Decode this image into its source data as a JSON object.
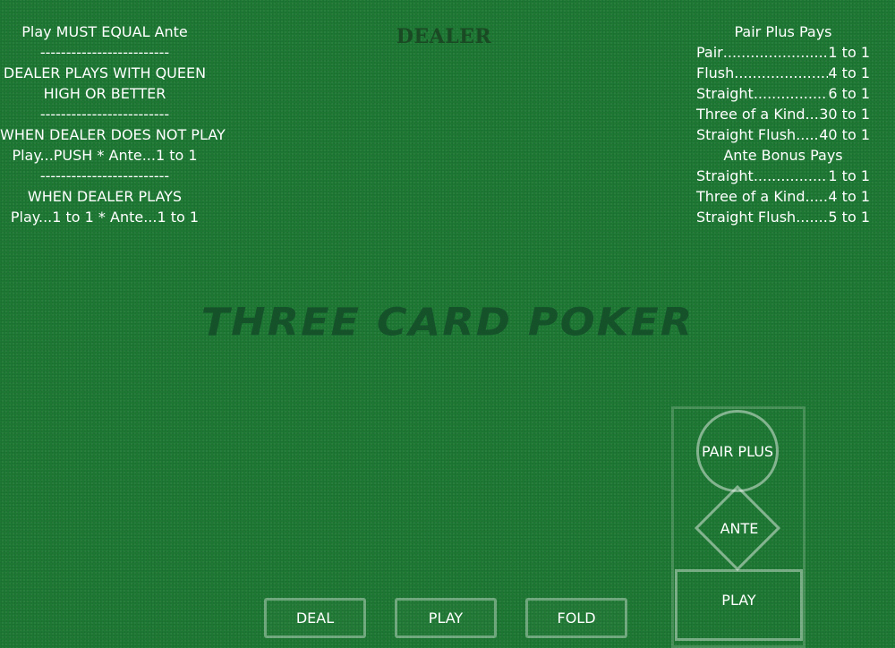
{
  "rules": {
    "lines": [
      "Play MUST EQUAL Ante",
      "-------------------------",
      "DEALER PLAYS WITH QUEEN",
      "HIGH OR BETTER",
      "-------------------------",
      "WHEN DEALER DOES NOT PLAY",
      "Play...PUSH * Ante...1 to 1",
      "-------------------------",
      "WHEN DEALER PLAYS",
      "Play...1 to 1 * Ante...1 to 1"
    ]
  },
  "dealer_label": "DEALER",
  "paytable": {
    "pair_plus_title": "Pair Plus Pays",
    "pair_plus": [
      {
        "hand": "Pair",
        "pay": "1 to 1"
      },
      {
        "hand": "Flush",
        "pay": "4 to 1"
      },
      {
        "hand": "Straight",
        "pay": "6 to 1"
      },
      {
        "hand": "Three of a Kind",
        "pay": "30 to 1"
      },
      {
        "hand": "Straight Flush",
        "pay": "40 to 1"
      }
    ],
    "ante_bonus_title": "Ante Bonus Pays",
    "ante_bonus": [
      {
        "hand": "Straight",
        "pay": "1 to 1"
      },
      {
        "hand": "Three of a Kind",
        "pay": "4 to 1"
      },
      {
        "hand": "Straight Flush",
        "pay": "5 to 1"
      }
    ]
  },
  "table_title": "THREE CARD POKER",
  "bet_spots": {
    "pair_plus": "PAIR PLUS",
    "ante": "ANTE",
    "play": "PLAY"
  },
  "buttons": {
    "deal": "DEAL",
    "play": "PLAY",
    "fold": "FOLD"
  },
  "colors": {
    "felt": "#1e7a34",
    "title_text": "#15522a",
    "text": "#ffffff"
  }
}
